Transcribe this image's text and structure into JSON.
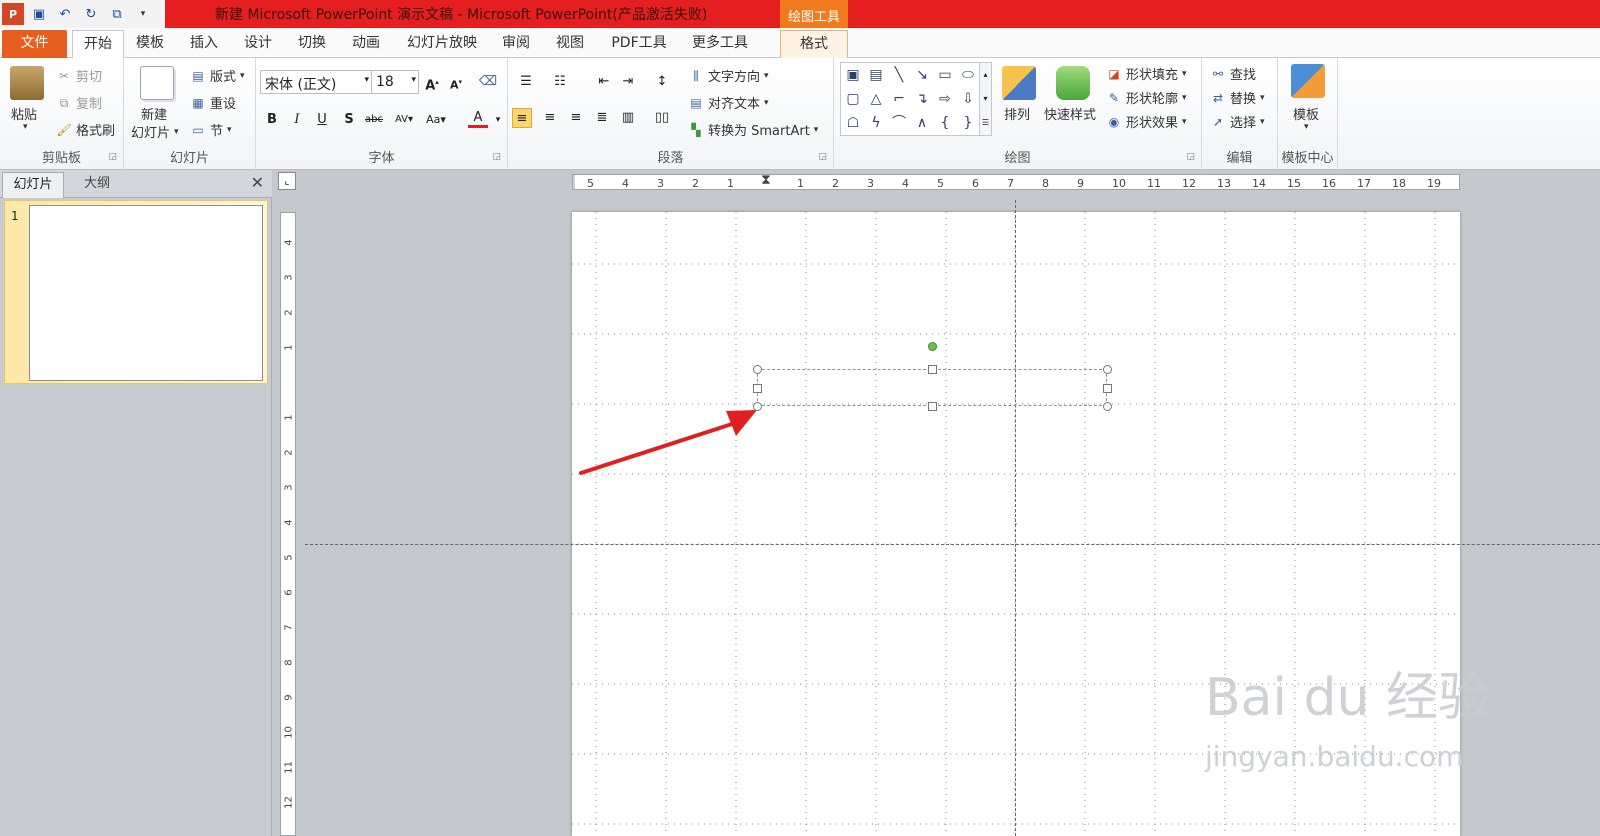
{
  "window": {
    "title": "新建 Microsoft PowerPoint 演示文稿 - Microsoft PowerPoint(产品激活失败)",
    "context_tool": "绘图工具"
  },
  "qat": {
    "icons": [
      "powerpoint-logo-icon",
      "save-icon",
      "undo-icon",
      "redo-icon",
      "customize-icon",
      "dropdown-icon"
    ]
  },
  "tabs": [
    "文件",
    "开始",
    "模板",
    "插入",
    "设计",
    "切换",
    "动画",
    "幻灯片放映",
    "审阅",
    "视图",
    "PDF工具",
    "更多工具",
    "格式"
  ],
  "ribbon": {
    "clipboard": {
      "label": "剪贴板",
      "paste": "粘贴",
      "cut": "剪切",
      "copy": "复制",
      "format_painter": "格式刷"
    },
    "slides": {
      "label": "幻灯片",
      "new_slide_1": "新建",
      "new_slide_2": "幻灯片",
      "layout": "版式",
      "reset": "重设",
      "section": "节"
    },
    "font": {
      "label": "字体",
      "font_name": "宋体 (正文)",
      "font_size": "18"
    },
    "paragraph": {
      "label": "段落",
      "text_direction": "文字方向",
      "align_text": "对齐文本",
      "smartart": "转换为 SmartArt"
    },
    "drawing": {
      "label": "绘图",
      "arrange": "排列",
      "quick_styles": "快速样式",
      "shape_fill": "形状填充",
      "shape_outline": "形状轮廓",
      "shape_effects": "形状效果"
    },
    "editing": {
      "label": "编辑",
      "find": "查找",
      "replace": "替换",
      "select": "选择"
    },
    "template": {
      "label": "模板中心",
      "template": "模板"
    }
  },
  "panel": {
    "tab_slides": "幻灯片",
    "tab_outline": "大纲",
    "slide_number": "1"
  },
  "ruler": {
    "h_ticks": [
      "5",
      "4",
      "3",
      "2",
      "1",
      "1",
      "2",
      "3",
      "4",
      "5",
      "6",
      "7",
      "8",
      "9",
      "10",
      "11",
      "12",
      "13",
      "14",
      "15",
      "16",
      "17",
      "18",
      "19"
    ],
    "v_ticks": [
      "4",
      "3",
      "2",
      "1",
      "1",
      "2",
      "3",
      "4",
      "5",
      "6",
      "7",
      "8",
      "9",
      "10",
      "11",
      "12"
    ]
  },
  "watermark": {
    "line1": "Bai du 经验",
    "line2": "jingyan.baidu.com"
  },
  "colors": {
    "title_red": "#e51f1f",
    "file_tab": "#e65f1e",
    "context_orange": "#f07a1d",
    "arrow_red": "#e02020"
  }
}
